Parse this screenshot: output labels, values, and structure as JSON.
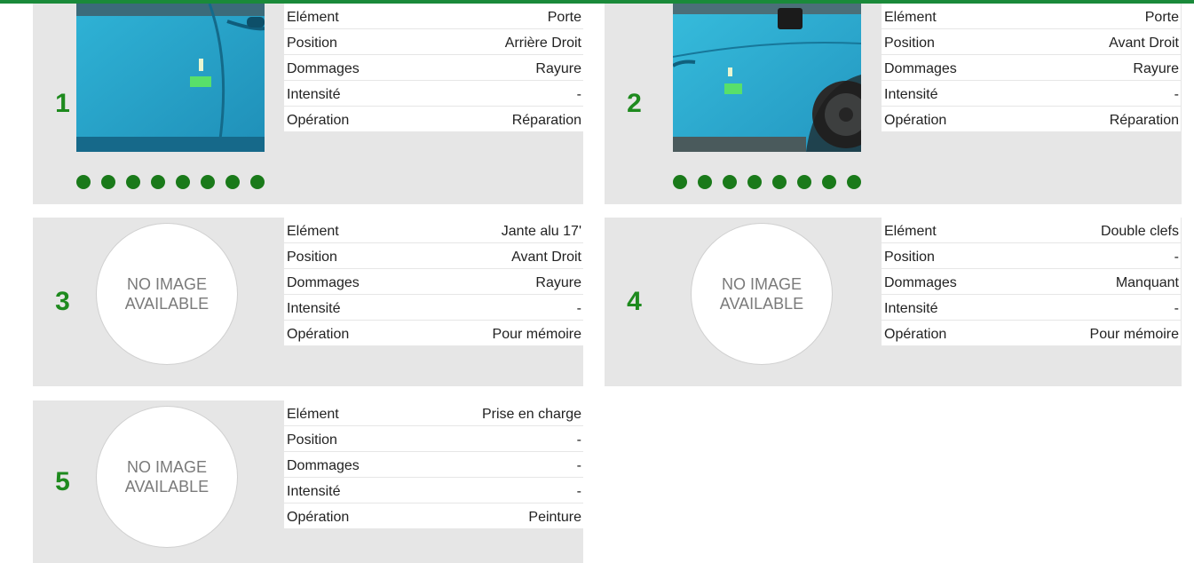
{
  "labels": {
    "element": "Elément",
    "position": "Position",
    "dommages": "Dommages",
    "intensite": "Intensité",
    "operation": "Opération"
  },
  "no_image": {
    "line1": "NO IMAGE",
    "line2": "AVAILABLE"
  },
  "colors": {
    "accent": "#1e8a1e",
    "dot": "#1a7a1a",
    "panel": "#e6e6e6"
  },
  "items": [
    {
      "number": "1",
      "element": "Porte",
      "position": "Arrière Droit",
      "dommages": "Rayure",
      "intensite": "-",
      "operation": "Réparation",
      "has_photo": true,
      "photo_count": 8
    },
    {
      "number": "2",
      "element": "Porte",
      "position": "Avant Droit",
      "dommages": "Rayure",
      "intensite": "-",
      "operation": "Réparation",
      "has_photo": true,
      "photo_count": 8
    },
    {
      "number": "3",
      "element": "Jante alu 17'",
      "position": "Avant Droit",
      "dommages": "Rayure",
      "intensite": "-",
      "operation": "Pour mémoire",
      "has_photo": false
    },
    {
      "number": "4",
      "element": "Double clefs",
      "position": "-",
      "dommages": "Manquant",
      "intensite": "-",
      "operation": "Pour mémoire",
      "has_photo": false
    },
    {
      "number": "5",
      "element": "Prise en charge",
      "position": "-",
      "dommages": "-",
      "intensite": "-",
      "operation": "Peinture",
      "has_photo": false
    }
  ]
}
